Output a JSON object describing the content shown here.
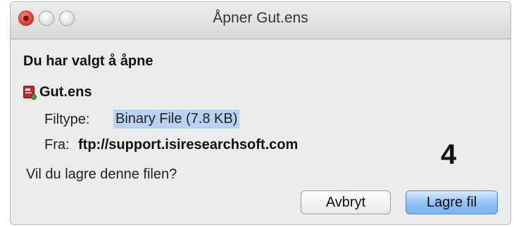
{
  "window": {
    "title": "Åpner Gut.ens"
  },
  "dialog": {
    "heading": "Du har valgt å åpne",
    "file_name": "Gut.ens",
    "file_icon": "endnote-file-icon",
    "filetype_label": "Filtype:",
    "filetype_value": "Binary File (7.8  KB)",
    "from_label": "Fra:",
    "from_value": "ftp://support.isiresearchsoft.com",
    "question": "Vil du lagre denne filen?",
    "step_number": "4"
  },
  "buttons": {
    "cancel_label": "Avbryt",
    "save_label": "Lagre fil"
  },
  "colors": {
    "highlight": "#b8d3f2",
    "default_button": "#8fc0f5",
    "close_button": "#e3473b"
  }
}
